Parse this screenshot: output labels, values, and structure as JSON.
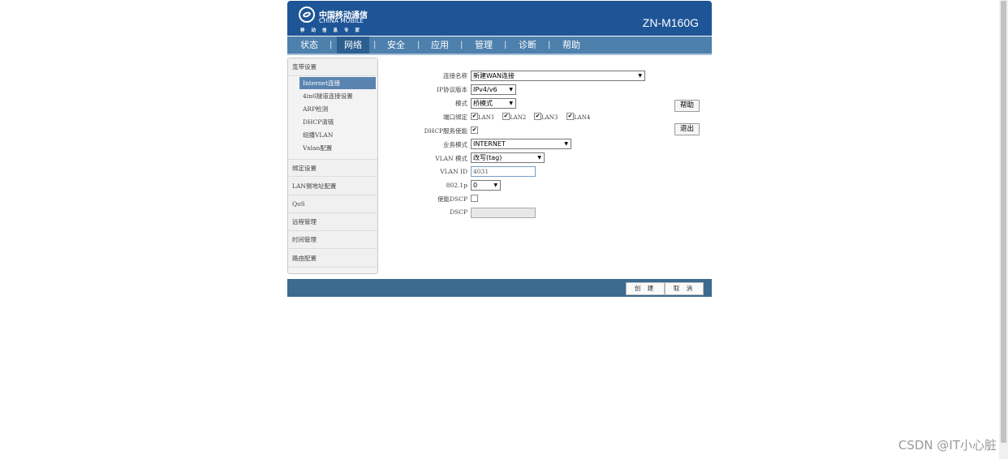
{
  "header": {
    "logo_cn": "中国移动通信",
    "logo_en": "CHINA MOBILE",
    "logo_slogan": "移动信息专家",
    "model": "ZN-M160G"
  },
  "nav": {
    "items": [
      "状态",
      "网络",
      "安全",
      "应用",
      "管理",
      "诊断",
      "帮助"
    ],
    "active": "网络",
    "separator": "|"
  },
  "sidebar": {
    "main": [
      "宽带设置",
      "绑定设置",
      "LAN侧地址配置",
      "QoS",
      "远程管理",
      "时间管理",
      "路由配置"
    ],
    "sub": [
      "Internet连接",
      "4in6隧道连接设置",
      "ARP检测",
      "DHCP清链",
      "组播VLAN",
      "Vxlan配置"
    ],
    "active_sub": "Internet连接"
  },
  "form": {
    "connection_name": {
      "label": "连接名称",
      "value": "新建WAN连接"
    },
    "ip_version": {
      "label": "IP协议版本",
      "value": "IPv4/v6"
    },
    "mode": {
      "label": "模式",
      "value": "桥模式"
    },
    "port_binding": {
      "label": "端口绑定",
      "ports": [
        "LAN1",
        "LAN2",
        "LAN3",
        "LAN4"
      ]
    },
    "dhcp_enable": {
      "label": "DHCP服务使能"
    },
    "service_mode": {
      "label": "业务模式",
      "value": "INTERNET"
    },
    "vlan_mode": {
      "label": "VLAN 模式",
      "value": "改写(tag)"
    },
    "vlan_id": {
      "label": "VLAN ID",
      "value": "4031"
    },
    "p8021": {
      "label": "802.1p",
      "value": "0"
    },
    "dscp_enable": {
      "label": "使能DSCP"
    },
    "dscp": {
      "label": "DSCP",
      "value": ""
    }
  },
  "buttons": {
    "help": "帮助",
    "logout": "退出",
    "create": "创 建",
    "cancel": "取 消"
  },
  "icons": {
    "checkmark": "✔",
    "dropdown": "▼"
  },
  "watermark": "CSDN @IT小心脏",
  "colors": {
    "header": "#1e5596",
    "nav": "#4e80ad",
    "active_nav": "#2c5f8f",
    "footer": "#3d6a8f",
    "sidebar_active": "#5a84b0"
  }
}
